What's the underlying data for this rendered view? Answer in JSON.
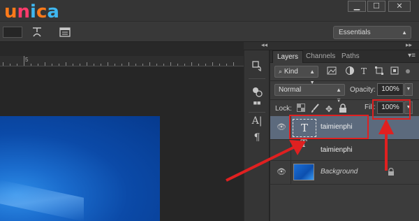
{
  "logo": {
    "letters": [
      "u",
      "n",
      "i",
      "c",
      "a"
    ],
    "colors": [
      "#ff7a1a",
      "#ff3b6b",
      "#3fb7f0",
      "#ff7a1a",
      "#3fb7f0"
    ]
  },
  "window_controls": [
    "▁",
    "☐",
    "✕"
  ],
  "options_bar": {
    "workspace_value": "Essentials"
  },
  "ruler": {
    "label": "5"
  },
  "layers_panel": {
    "tabs": [
      {
        "label": "Layers",
        "active": true
      },
      {
        "label": "Channels",
        "active": false
      },
      {
        "label": "Paths",
        "active": false
      }
    ],
    "filter_kind": "Kind",
    "blend_mode": "Normal",
    "opacity_label": "Opacity:",
    "opacity_value": "100%",
    "lock_label": "Lock:",
    "fill_label": "Fill:",
    "fill_value": "100%",
    "layers": [
      {
        "name": "taimienphi",
        "type": "text",
        "selected": true
      },
      {
        "name": "taimienphi",
        "type": "text",
        "selected": false
      },
      {
        "name": "Background",
        "type": "image",
        "selected": false,
        "locked": true
      }
    ]
  },
  "icons": {
    "eye": "eye-icon",
    "lock": "lock-icon",
    "text_layer": "text-layer-thumbnail",
    "search": "search-icon"
  },
  "colors": {
    "annotation_red": "#e02020",
    "selected_layer": "#5c6a7d",
    "panel_bg": "#3c3c3c"
  }
}
